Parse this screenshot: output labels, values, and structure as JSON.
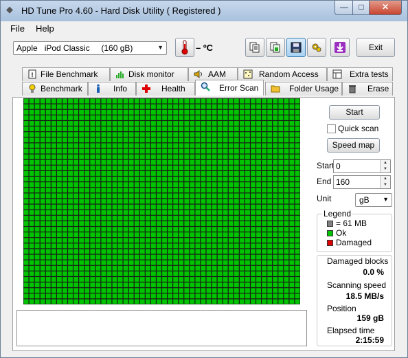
{
  "window": {
    "title": "HD Tune Pro 4.60 - Hard Disk Utility ( Registered )",
    "controls": {
      "minimize": "—",
      "maximize": "□",
      "close": "✕"
    }
  },
  "menu": {
    "file": "File",
    "help": "Help"
  },
  "toolbar": {
    "drive": "Apple   iPod Classic     (160 gB)",
    "temperature": "– ºC",
    "exit": "Exit",
    "icons": [
      "thermometer-icon",
      "copy-text-icon",
      "copy-screenshot-icon",
      "save-icon",
      "options-icon",
      "download-icon"
    ]
  },
  "tabs": {
    "row_back": [
      "File Benchmark",
      "Disk monitor",
      "AAM",
      "Random Access",
      "Extra tests"
    ],
    "row_front": [
      "Benchmark",
      "Info",
      "Health",
      "Error Scan",
      "Folder Usage",
      "Erase"
    ],
    "active": "Error Scan"
  },
  "scan": {
    "start_button": "Start",
    "quick_scan": "Quick scan",
    "quick_scan_checked": false,
    "speed_map_button": "Speed map",
    "start_label": "Start",
    "start_value": "0",
    "end_label": "End",
    "end_value": "160",
    "unit_label": "Unit",
    "unit_value": "gB",
    "block_state": "Ok",
    "grid_cols": 50,
    "grid_rows": 37
  },
  "legend": {
    "title": "Legend",
    "block_size": "= 61 MB",
    "ok": "Ok",
    "damaged": "Damaged",
    "colors": {
      "block": "#808080",
      "ok": "#00c400",
      "damaged": "#e00000"
    }
  },
  "stats": {
    "damaged_blocks_label": "Damaged blocks",
    "damaged_blocks_value": "0.0 %",
    "scanning_speed_label": "Scanning speed",
    "scanning_speed_value": "18.5 MB/s",
    "position_label": "Position",
    "position_value": "159 gB",
    "elapsed_label": "Elapsed time",
    "elapsed_value": "2:15:59"
  }
}
